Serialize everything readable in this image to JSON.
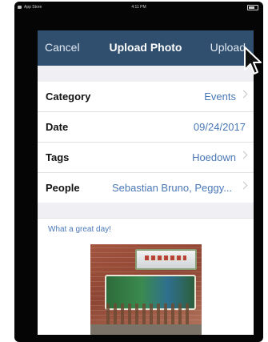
{
  "status_bar": {
    "carrier": "App Store",
    "time": "4:11 PM"
  },
  "nav": {
    "cancel_label": "Cancel",
    "title": "Upload Photo",
    "upload_label": "Upload"
  },
  "form": {
    "rows": [
      {
        "label": "Category",
        "value": "Events"
      },
      {
        "label": "Date",
        "value": "09/24/2017"
      },
      {
        "label": "Tags",
        "value": "Hoedown"
      },
      {
        "label": "People",
        "value": "Sebastian Bruno, Peggy..."
      }
    ]
  },
  "caption": {
    "text": "What a great day!"
  },
  "colors": {
    "nav_bar": "#304e6d",
    "accent_value": "#4a78b7",
    "background": "#efeff4"
  },
  "icons": {
    "row_disclosure": "chevron-right-icon",
    "pointer": "cursor-arrow-icon"
  }
}
